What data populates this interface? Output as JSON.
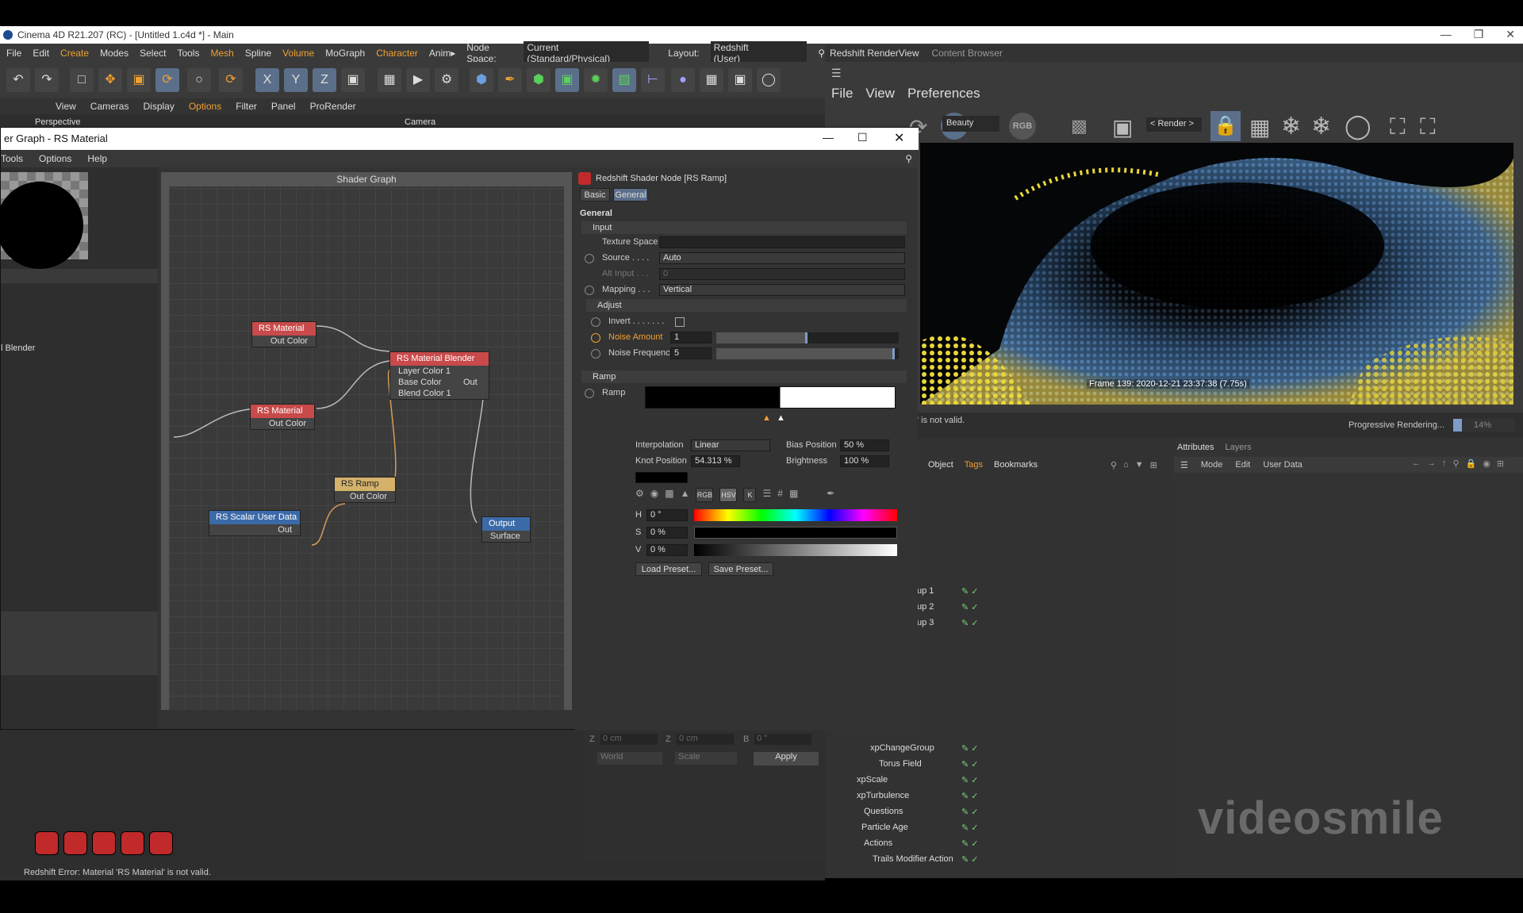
{
  "app": {
    "title": "Cinema 4D R21.207 (RC) - [Untitled 1.c4d *] - Main"
  },
  "menu": [
    "File",
    "Edit",
    "Create",
    "Modes",
    "Select",
    "Tools",
    "Mesh",
    "Spline",
    "Volume",
    "MoGraph",
    "Character",
    "Anim▸"
  ],
  "node_space": {
    "label": "Node Space:",
    "value": "Current (Standard/Physical)"
  },
  "layout": {
    "label": "Layout:",
    "value": "Redshift (User)"
  },
  "viewport_menu": [
    "View",
    "Cameras",
    "Display",
    "Options",
    "Filter",
    "Panel",
    "ProRender"
  ],
  "viewport": {
    "name": "Perspective",
    "camera": "Camera"
  },
  "renderview": {
    "tabs": [
      "Redshift RenderView",
      "Content Browser"
    ],
    "menu": [
      "File",
      "View",
      "Preferences"
    ],
    "aov": "Beauty",
    "rgb": "RGB",
    "render_dropdown": "< Render >",
    "frame_info": "Frame 139:  2020-12-21  23:37:38  (7.75s)",
    "status_left": "' is not valid.",
    "status_right": "Progressive Rendering...",
    "progress": "14%"
  },
  "object_manager": {
    "menu": [
      "Object",
      "Tags",
      "Bookmarks"
    ],
    "items": [
      {
        "label": "up 1"
      },
      {
        "label": "up 2"
      },
      {
        "label": "up 3"
      },
      {
        "label": "xpChangeGroup"
      },
      {
        "label": "Torus Field"
      },
      {
        "label": "xpScale"
      },
      {
        "label": "xpTurbulence"
      },
      {
        "label": "Questions"
      },
      {
        "label": "Particle Age"
      },
      {
        "label": "Actions"
      },
      {
        "label": "Trails Modifier Action"
      }
    ]
  },
  "attributes": {
    "tabs": [
      "Attributes",
      "Layers"
    ],
    "menu": [
      "Mode",
      "Edit",
      "User Data"
    ]
  },
  "coords": {
    "z1": "0 cm",
    "z2": "0 cm",
    "b": "0 °",
    "world": "World",
    "scale": "Scale",
    "apply": "Apply"
  },
  "status_bar": {
    "text": "Redshift Error: Material 'RS Material' is not valid."
  },
  "dialog": {
    "title": "er Graph - RS Material",
    "menu": [
      "Tools",
      "Options",
      "Help"
    ],
    "list_label": "l Blender",
    "graph_title": "Shader Graph",
    "nodes": {
      "mat1": {
        "title": "RS Material",
        "out": "Out Color"
      },
      "mat2": {
        "title": "RS Material",
        "out": "Out Color"
      },
      "blender": {
        "title": "RS Material Blender",
        "p1": "Layer Color 1",
        "p2": "Base Color",
        "p3": "Blend Color 1",
        "out": "Out"
      },
      "ramp": {
        "title": "RS Ramp",
        "out": "Out Color"
      },
      "scalar": {
        "title": "RS Scalar User Data",
        "out": "Out"
      },
      "output": {
        "title": "Output",
        "in": "Surface"
      }
    },
    "props": {
      "header": "Redshift Shader Node [RS Ramp]",
      "tabs": [
        "Basic",
        "General"
      ],
      "section": "General",
      "input": "Input",
      "texture_space": "Texture Space",
      "source_label": "Source . . . .",
      "source_value": "Auto",
      "alt_input_label": "Alt Input . . .",
      "alt_input_value": "0",
      "mapping_label": "Mapping . . .",
      "mapping_value": "Vertical",
      "adjust": "Adjust",
      "invert_label": "Invert . . . . . . .",
      "noise_amount_label": "Noise Amount",
      "noise_amount_value": "1",
      "noise_amount_fill": 0.5,
      "noise_freq_label": "Noise Frequency",
      "noise_freq_value": "5",
      "noise_freq_fill": 0.98,
      "ramp_section": "Ramp",
      "ramp_label": "Ramp",
      "interp_label": "Interpolation",
      "interp_value": "Linear",
      "bias_label": "Bias Position",
      "bias_value": "50 %",
      "knot_label": "Knot Position",
      "knot_value": "54.313 %",
      "bright_label": "Brightness",
      "bright_value": "100 %",
      "h_label": "H",
      "h_value": "0 °",
      "s_label": "S",
      "s_value": "0 %",
      "v_label": "V",
      "v_value": "0 %",
      "rgb": "RGB",
      "hsv": "HSV",
      "k": "K",
      "load": "Load Preset...",
      "save": "Save Preset..."
    }
  },
  "watermark": "videosmile",
  "colors": {
    "accent": "#f0a030",
    "node_red": "#c84a4a",
    "node_blue": "#3b6aa8",
    "node_ramp": "#d4b26a",
    "selection": "#5b6f8a"
  }
}
